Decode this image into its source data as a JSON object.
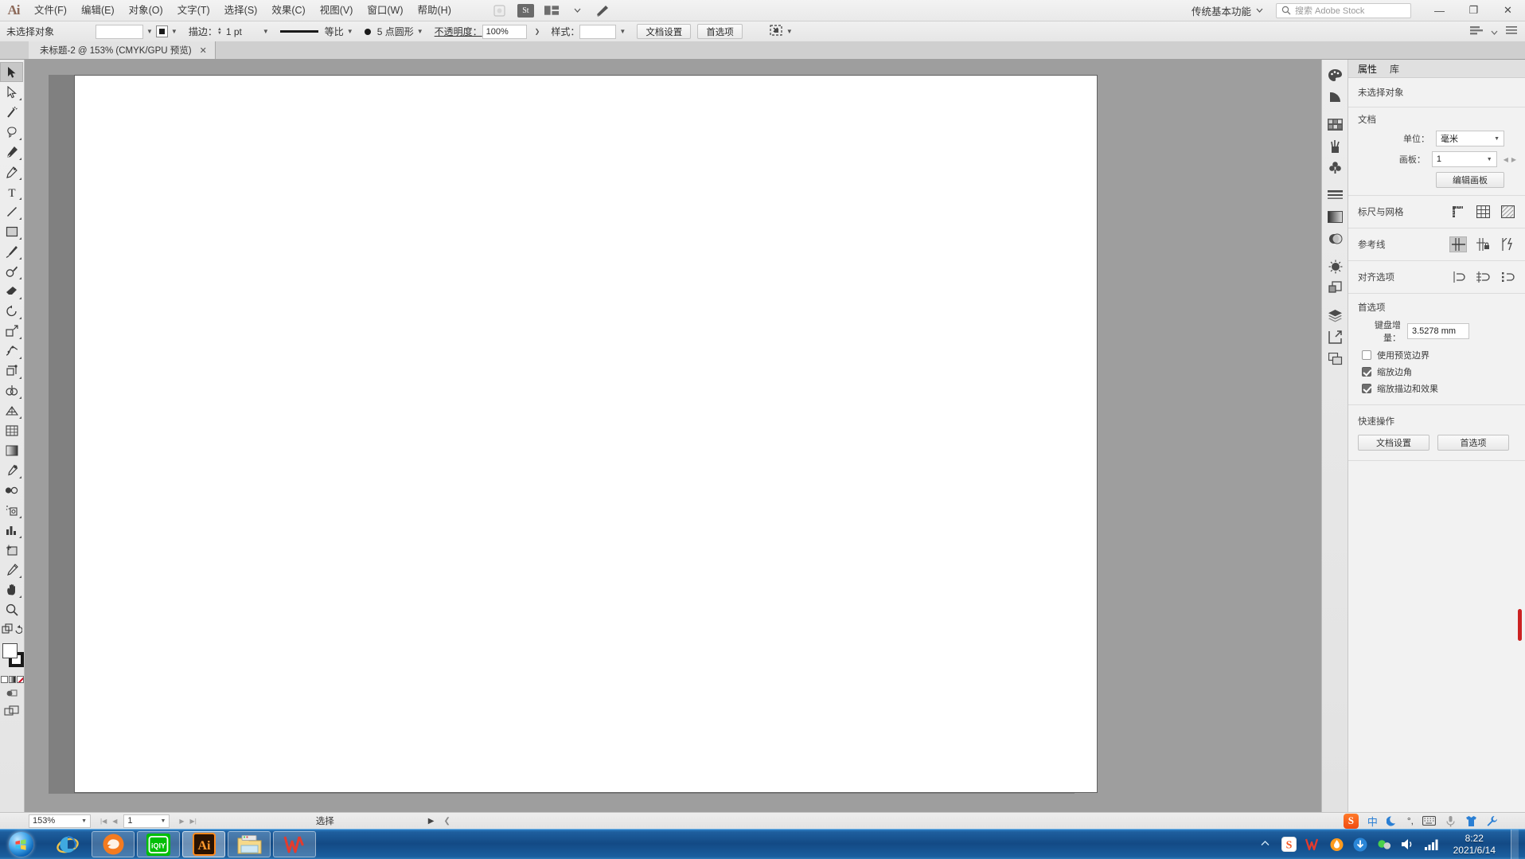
{
  "app": {
    "logo": "Ai",
    "workspace": "传统基本功能",
    "search_placeholder": "搜索 Adobe Stock"
  },
  "menubar": {
    "items": [
      {
        "label": "文件(F)"
      },
      {
        "label": "编辑(E)"
      },
      {
        "label": "对象(O)"
      },
      {
        "label": "文字(T)"
      },
      {
        "label": "选择(S)"
      },
      {
        "label": "效果(C)"
      },
      {
        "label": "视图(V)"
      },
      {
        "label": "窗口(W)"
      },
      {
        "label": "帮助(H)"
      }
    ],
    "stock_badge": "St",
    "window_buttons": {
      "minimize": "—",
      "maximize": "❐",
      "close": "✕"
    }
  },
  "controlbar": {
    "selection_status": "未选择对象",
    "stroke_label": "描边：",
    "stroke_weight": "1 pt",
    "stroke_profile": "等比",
    "brush_def": "5 点圆形",
    "opacity_label": "不透明度：",
    "opacity_value": "100%",
    "style_label": "样式：",
    "doc_setup": "文档设置",
    "preferences": "首选项"
  },
  "tabbar": {
    "document_tab": "未标题-2 @ 153% (CMYK/GPU 预览)",
    "close": "✕"
  },
  "toolbar": {
    "tools": [
      {
        "name": "selection-tool",
        "selected": true
      },
      {
        "name": "direct-selection-tool",
        "selected": false
      },
      {
        "name": "magic-wand-tool",
        "selected": false
      },
      {
        "name": "lasso-tool",
        "selected": false
      },
      {
        "name": "pen-tool",
        "selected": false
      },
      {
        "name": "curvature-tool",
        "selected": false
      },
      {
        "name": "type-tool",
        "selected": false
      },
      {
        "name": "line-segment-tool",
        "selected": false
      },
      {
        "name": "rectangle-tool",
        "selected": false
      },
      {
        "name": "paintbrush-tool",
        "selected": false
      },
      {
        "name": "shaper-tool",
        "selected": false
      },
      {
        "name": "eraser-tool",
        "selected": false
      },
      {
        "name": "rotate-tool",
        "selected": false
      },
      {
        "name": "scale-tool",
        "selected": false
      },
      {
        "name": "width-tool",
        "selected": false
      },
      {
        "name": "free-transform-tool",
        "selected": false
      },
      {
        "name": "shape-builder-tool",
        "selected": false
      },
      {
        "name": "perspective-grid-tool",
        "selected": false
      },
      {
        "name": "mesh-tool",
        "selected": false
      },
      {
        "name": "gradient-tool",
        "selected": false
      },
      {
        "name": "eyedropper-tool",
        "selected": false
      },
      {
        "name": "blend-tool",
        "selected": false
      },
      {
        "name": "symbol-sprayer-tool",
        "selected": false
      },
      {
        "name": "column-graph-tool",
        "selected": false
      },
      {
        "name": "artboard-tool",
        "selected": false
      },
      {
        "name": "slice-tool",
        "selected": false
      },
      {
        "name": "hand-tool",
        "selected": false
      },
      {
        "name": "zoom-tool",
        "selected": false
      }
    ]
  },
  "properties": {
    "tabs": [
      {
        "label": "属性",
        "active": true
      },
      {
        "label": "库",
        "active": false
      }
    ],
    "no_selection": "未选择对象",
    "document": {
      "title": "文档",
      "unit_label": "单位：",
      "unit_value": "毫米",
      "artboard_label": "画板：",
      "artboard_value": "1",
      "edit_artboards": "编辑画板"
    },
    "rulers_grid": {
      "title": "标尺与网格"
    },
    "guides": {
      "title": "参考线"
    },
    "align": {
      "title": "对齐选项"
    },
    "preferences": {
      "title": "首选项",
      "keyboard_increment_label": "键盘增量：",
      "keyboard_increment_value": "3.5278 mm",
      "checkboxes": [
        {
          "label": "使用预览边界",
          "checked": false
        },
        {
          "label": "缩放边角",
          "checked": true
        },
        {
          "label": "缩放描边和效果",
          "checked": true
        }
      ]
    },
    "quick_actions": {
      "title": "快速操作",
      "buttons": [
        {
          "label": "文档设置"
        },
        {
          "label": "首选项"
        }
      ]
    }
  },
  "panel_rail": {
    "icons": [
      {
        "name": "color-icon"
      },
      {
        "name": "color-guide-icon"
      },
      {
        "name": "swatches-icon"
      },
      {
        "name": "brushes-icon"
      },
      {
        "name": "symbols-icon"
      },
      {
        "name": "stroke-icon"
      },
      {
        "name": "gradient-icon"
      },
      {
        "name": "transparency-icon"
      },
      {
        "name": "appearance-icon"
      },
      {
        "name": "pathfinder-icon"
      },
      {
        "name": "layers-icon"
      },
      {
        "name": "asset-export-icon"
      },
      {
        "name": "artboards-icon"
      }
    ]
  },
  "statusbar": {
    "zoom": "153%",
    "page": "1",
    "current_tool": "选择"
  },
  "taskbar": {
    "items": [
      {
        "name": "internet-explorer",
        "label": "e"
      },
      {
        "name": "firefox-browser",
        "label": ""
      },
      {
        "name": "iqiyi-app",
        "label": "iQIY"
      },
      {
        "name": "adobe-illustrator",
        "label": "Ai",
        "active": true
      },
      {
        "name": "file-explorer",
        "label": ""
      },
      {
        "name": "wps-office",
        "label": "W"
      }
    ],
    "tray": {
      "ime": "中",
      "icons": [
        "sogou",
        "wps",
        "flame",
        "update",
        "green-dot",
        "volume",
        "network"
      ]
    },
    "clock": {
      "time": "8:22",
      "date": "2021/6/14"
    }
  },
  "ime_bar": {
    "language": "中",
    "items": [
      "sogou-logo",
      "chinese-mode",
      "moon-icon",
      "punctuation-icon",
      "keyboard-icon",
      "voice-icon",
      "skin-icon",
      "tools-icon"
    ]
  },
  "colors": {
    "accent": "#ff7a2a",
    "canvas_bg": "#9e9e9e",
    "artboard": "#ffffff",
    "taskbar": "#134a85"
  }
}
